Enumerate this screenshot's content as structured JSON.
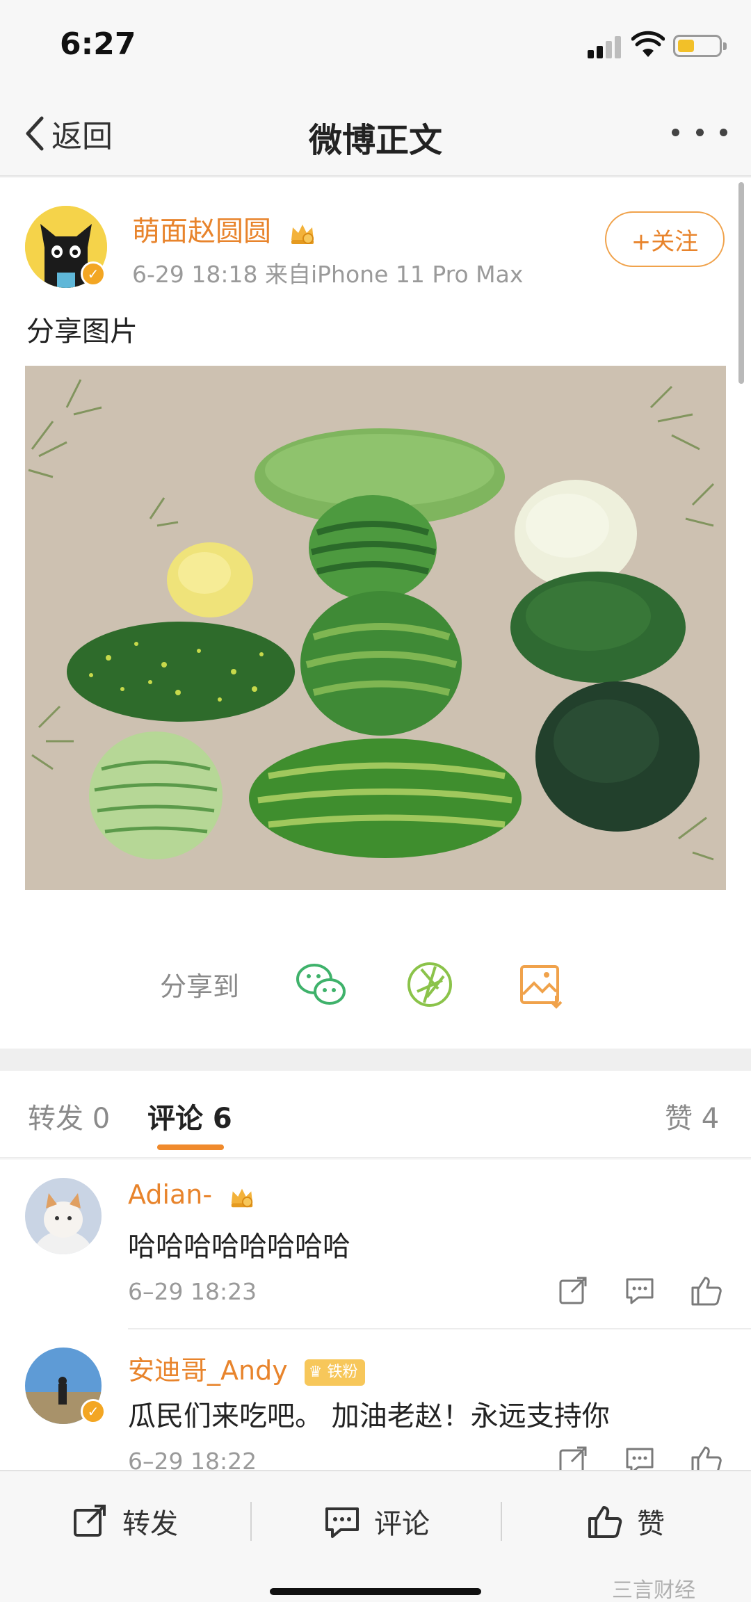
{
  "status_bar": {
    "time": "6:27",
    "battery_level": 0.4
  },
  "nav": {
    "back_label": "返回",
    "title": "微博正文",
    "more_icon": "more-horizontal-icon"
  },
  "post": {
    "author": "萌面赵圆圆",
    "meta": "6-29 18:18  来自iPhone 11 Pro Max",
    "follow_label": "+关注",
    "text": "分享图片",
    "image_icon": "watermelon-photo",
    "share_label": "分享到",
    "share_icons": [
      "wechat-icon",
      "moments-icon",
      "save-image-icon"
    ]
  },
  "tabs": [
    {
      "label": "转发 0"
    },
    {
      "label": "评论 6"
    },
    {
      "label": "赞 4"
    }
  ],
  "comments": [
    {
      "name": "Adian-",
      "text": "哈哈哈哈哈哈哈哈",
      "time": "6–29 18:23"
    },
    {
      "name": "安迪哥_Andy",
      "fan_badge": "铁粉",
      "text": "瓜民们来吃吧。 加油老赵！永远支持你",
      "time": "6–29 18:22"
    }
  ],
  "toolbar": {
    "repost": "转发",
    "comment": "评论",
    "like": "赞"
  },
  "watermark": "三言财经",
  "colors": {
    "accent": "#e8842c",
    "share_green": "#3fb26b",
    "save_orange": "#f0a24b"
  }
}
